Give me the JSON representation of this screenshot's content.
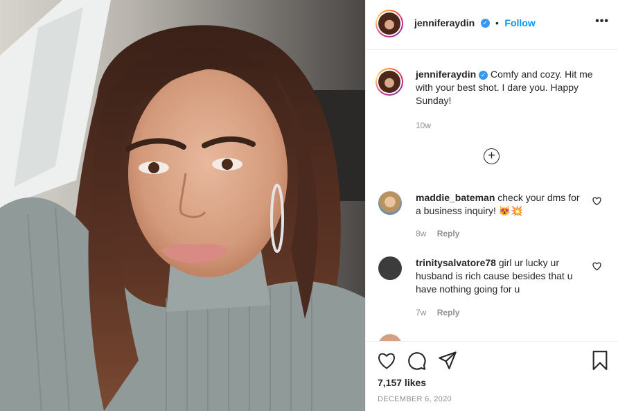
{
  "post": {
    "username": "jenniferaydin",
    "follow_label": "Follow",
    "separator": "•",
    "more_label": "•••"
  },
  "caption": {
    "username": "jenniferaydin",
    "text": "Comfy and cozy. Hit me with your best shot. I dare you. Happy Sunday!",
    "time": "10w"
  },
  "comments": [
    {
      "username": "maddie_bateman",
      "text": "check your dms for a business inquiry! 😻💥",
      "time": "8w",
      "reply_label": "Reply"
    },
    {
      "username": "trinitysalvatore78",
      "text": "girl ur lucky ur husband is rich cause besides that u have nothing going for u",
      "time": "7w",
      "reply_label": "Reply"
    }
  ],
  "engagement": {
    "likes": "7,157 likes",
    "date": "DECEMBER 6, 2020"
  },
  "icons": [
    "heart-icon",
    "comment-icon",
    "share-icon",
    "bookmark-icon",
    "add-comment-icon",
    "verified-badge-icon",
    "more-options-icon"
  ],
  "colors": {
    "link": "#0095f6",
    "verified": "#3897f0",
    "muted": "#8e8e8e",
    "text": "#262626"
  }
}
